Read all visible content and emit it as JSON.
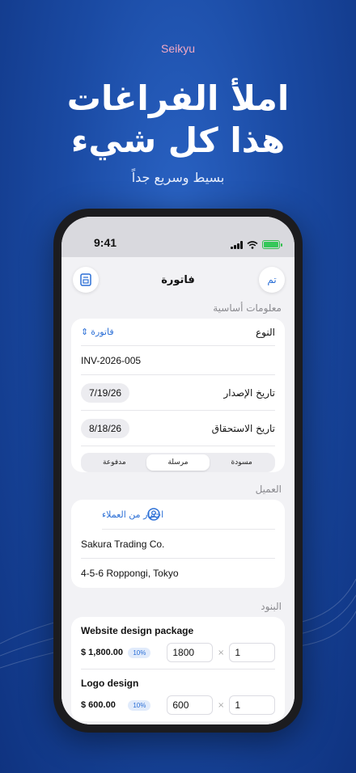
{
  "brand": "Seikyu",
  "headline": {
    "line1": "املأ الفراغات",
    "line2": "هذا كل شيء"
  },
  "subline": "بسيط وسريع جداً",
  "status": {
    "time": "9:41"
  },
  "nav": {
    "title": "فاتورة",
    "done": "تم",
    "left_icon": "document-icon"
  },
  "basic_info": {
    "section_label": "معلومات أساسية",
    "type_label": "النوع",
    "type_value": "فاتورة",
    "number": "INV-2026-005",
    "issue_label": "تاريخ الإصدار",
    "issue_date": "7/19/26",
    "due_label": "تاريخ الاستحقاق",
    "due_date": "8/18/26",
    "status_options": [
      "مسودة",
      "مرسلة",
      "مدفوعة"
    ],
    "status_selected": "مرسلة"
  },
  "client": {
    "section_label": "العميل",
    "pick_label": "اختيار من العملاء",
    "name": "Sakura Trading Co.",
    "address": "4-5-6 Roppongi, Tokyo"
  },
  "items": {
    "section_label": "البنود",
    "list": [
      {
        "name": "Website design package",
        "price": "$ 1,800.00",
        "tax": "10%",
        "unit_price": "1800",
        "times": "×",
        "qty": "1"
      },
      {
        "name": "Logo design",
        "price": "$ 600.00",
        "tax": "10%",
        "unit_price": "600",
        "times": "×",
        "qty": "1"
      }
    ]
  },
  "colors": {
    "accent": "#2b6fd6",
    "brand": "#f2a9c4",
    "background": "#1a4aa3"
  }
}
